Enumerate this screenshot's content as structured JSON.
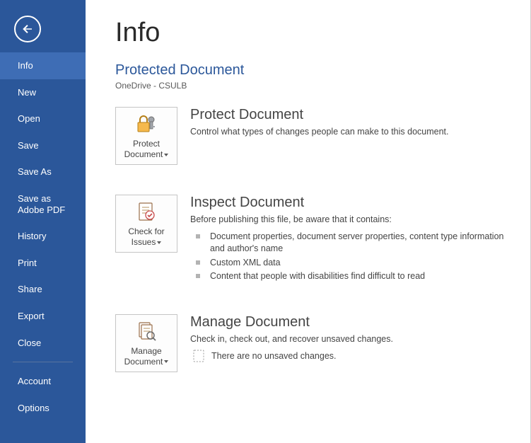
{
  "sidebar": {
    "items": [
      {
        "label": "Info",
        "selected": true
      },
      {
        "label": "New"
      },
      {
        "label": "Open"
      },
      {
        "label": "Save"
      },
      {
        "label": "Save As"
      },
      {
        "label": "Save as Adobe PDF"
      },
      {
        "label": "History"
      },
      {
        "label": "Print"
      },
      {
        "label": "Share"
      },
      {
        "label": "Export"
      },
      {
        "label": "Close"
      }
    ],
    "footer": [
      {
        "label": "Account"
      },
      {
        "label": "Options"
      }
    ]
  },
  "page": {
    "title": "Info",
    "doc_title": "Protected Document",
    "doc_location": "OneDrive - CSULB"
  },
  "protect": {
    "button_label": "Protect Document",
    "title": "Protect Document",
    "desc": "Control what types of changes people can make to this document."
  },
  "inspect": {
    "button_label": "Check for Issues",
    "title": "Inspect Document",
    "desc": "Before publishing this file, be aware that it contains:",
    "items": [
      "Document properties, document server properties, content type information and author's name",
      "Custom XML data",
      "Content that people with disabilities find difficult to read"
    ]
  },
  "manage": {
    "button_label": "Manage Document",
    "title": "Manage Document",
    "desc": "Check in, check out, and recover unsaved changes.",
    "status": "There are no unsaved changes."
  }
}
